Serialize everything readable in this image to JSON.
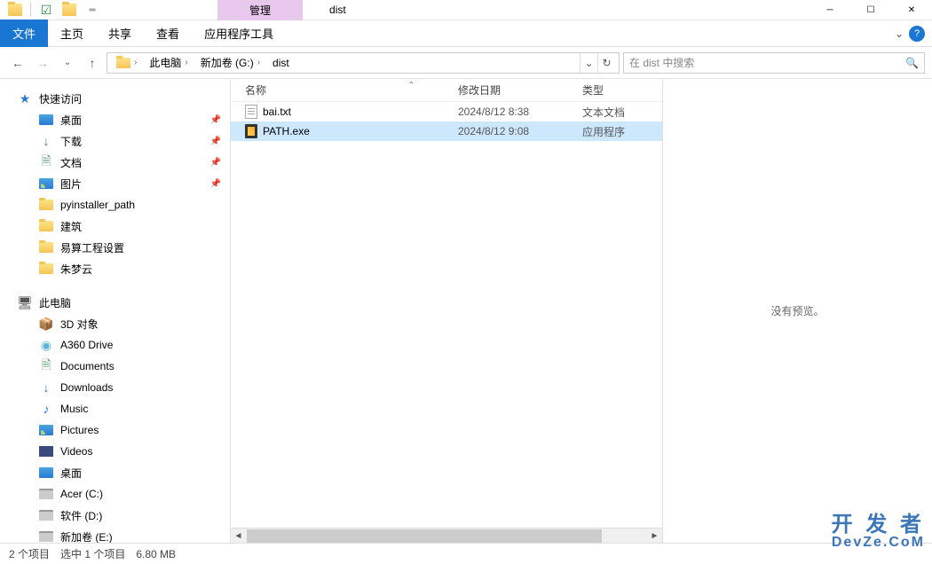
{
  "window": {
    "manage_tab": "管理",
    "title": "dist",
    "app_tools_tab": "应用程序工具"
  },
  "ribbon": {
    "file": "文件",
    "home": "主页",
    "share": "共享",
    "view": "查看"
  },
  "path": {
    "segments": [
      "此电脑",
      "新加卷 (G:)",
      "dist"
    ]
  },
  "search": {
    "placeholder": "在 dist 中搜索"
  },
  "sidebar": {
    "quick_access": "快速访问",
    "desktop": "桌面",
    "downloads": "下载",
    "documents": "文档",
    "pictures": "图片",
    "folders": [
      "pyinstaller_path",
      "建筑",
      "易算工程设置",
      "朱梦云"
    ],
    "this_pc": "此电脑",
    "pc_items": [
      "3D 对象",
      "A360 Drive",
      "Documents",
      "Downloads",
      "Music",
      "Pictures",
      "Videos",
      "桌面",
      "Acer (C:)",
      "软件 (D:)",
      "新加卷 (E:)"
    ]
  },
  "columns": {
    "name": "名称",
    "date": "修改日期",
    "type": "类型"
  },
  "files": [
    {
      "name": "bai.txt",
      "date": "2024/8/12 8:38",
      "type": "文本文档",
      "icon": "txt",
      "selected": false
    },
    {
      "name": "PATH.exe",
      "date": "2024/8/12 9:08",
      "type": "应用程序",
      "icon": "exe",
      "selected": true
    }
  ],
  "preview": {
    "no_preview": "没有预览。"
  },
  "status": {
    "items": "2 个项目",
    "selected": "选中 1 个项目",
    "size": "6.80 MB"
  },
  "watermark": {
    "line1": "开 发 者",
    "line2": "DevZe.CoM"
  }
}
